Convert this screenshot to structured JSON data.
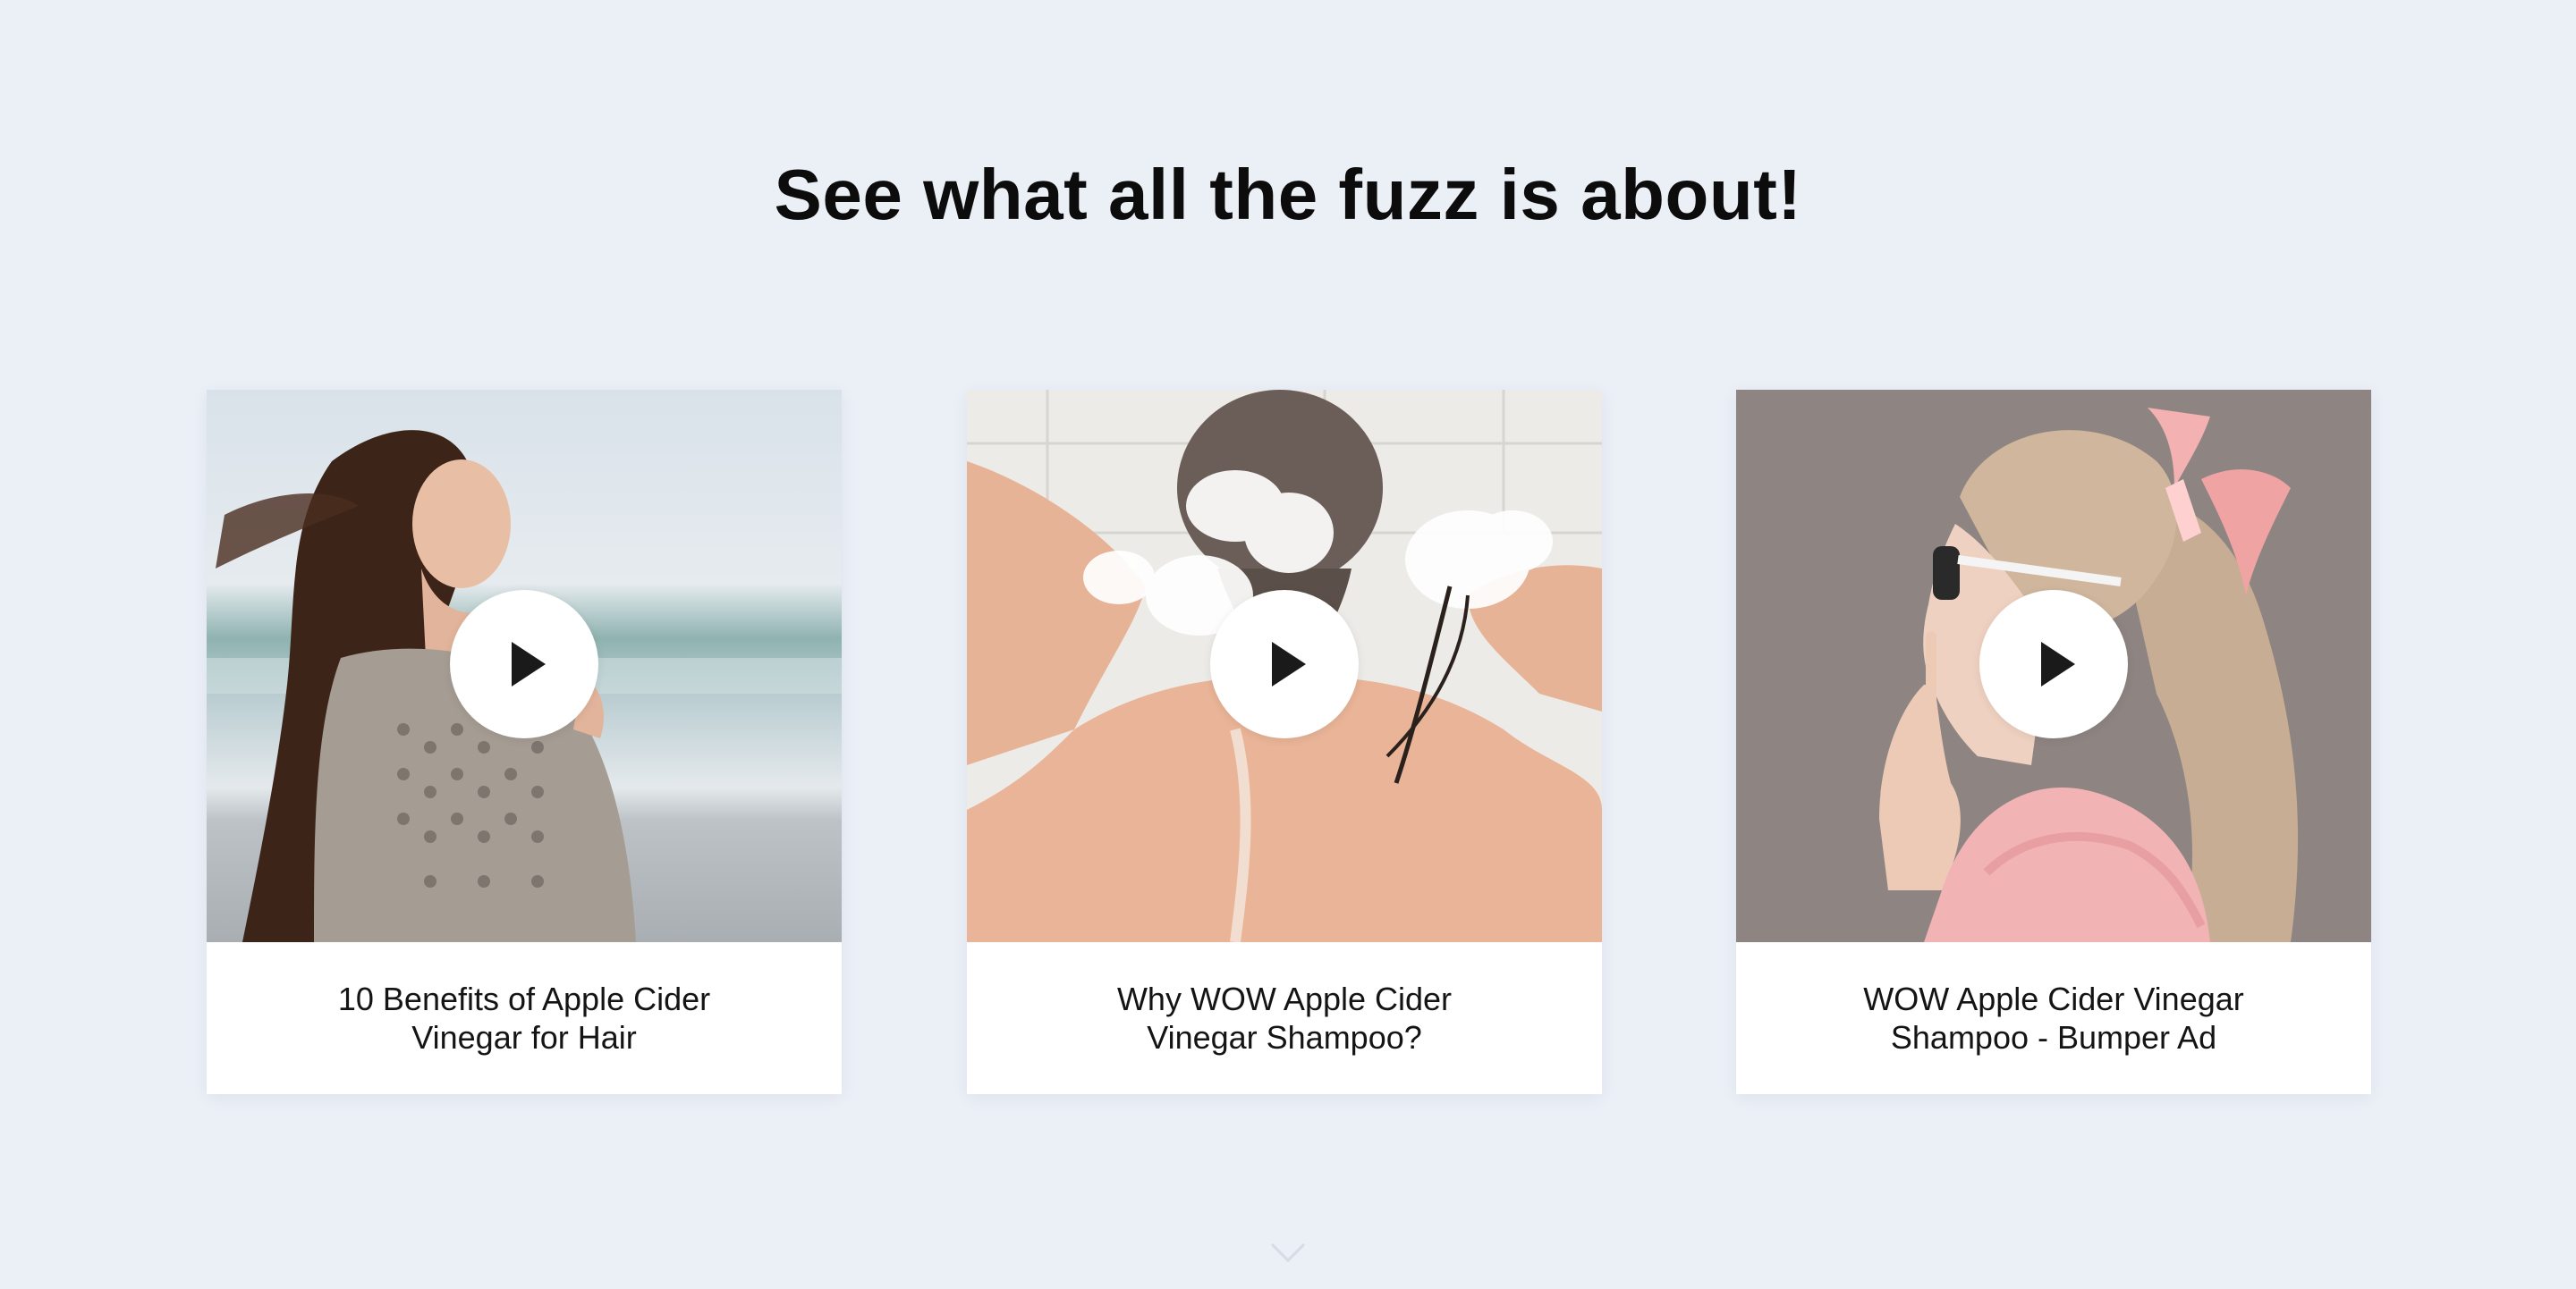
{
  "section": {
    "title": "See what all the fuzz is about!"
  },
  "videos": [
    {
      "caption": "10 Benefits of Apple Cider Vinegar for Hair",
      "thumbnail_icon": "woman-on-beach-photo",
      "play_icon": "play-icon"
    },
    {
      "caption": "Why WOW Apple Cider Vinegar Shampoo?",
      "thumbnail_icon": "woman-shampooing-hair-photo",
      "play_icon": "play-icon"
    },
    {
      "caption": "WOW Apple Cider Vinegar Shampoo - Bumper Ad",
      "thumbnail_icon": "woman-with-sunglasses-ponytail-photo",
      "play_icon": "play-icon"
    }
  ],
  "scroll_hint": {
    "icon": "chevron-down-icon"
  },
  "colors": {
    "page_background": "#ebeff6",
    "card_background": "#ffffff",
    "title_text": "#0c0c0c",
    "play_icon": "#1a1a1a"
  }
}
